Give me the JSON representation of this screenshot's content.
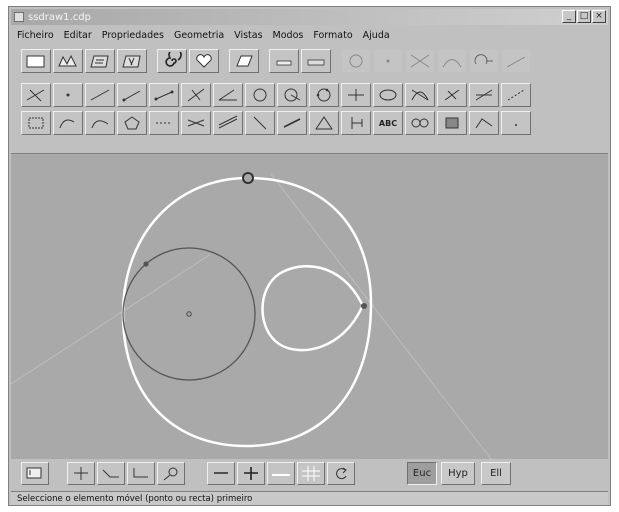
{
  "window": {
    "title": "ssdraw1.cdp"
  },
  "menu": [
    "Ficheiro",
    "Editar",
    "Propriedades",
    "Geometria",
    "Vistas",
    "Modos",
    "Formato",
    "Ajuda"
  ],
  "toolbar1": [
    "new-document-icon",
    "open-file-icon",
    "save-file-icon",
    "save-as-icon",
    "spiral-icon",
    "heart-icon",
    "print-icon",
    "eraser-icon",
    "rubber-icon",
    "circle-tool-icon",
    "dot-tool-icon",
    "tangent-lines-icon",
    "curve-tool-icon",
    "arc-tool-icon",
    "slant-line-icon"
  ],
  "toolbar2": [
    "point-icon",
    "midpoint-icon",
    "line-icon",
    "ray-icon",
    "segment-icon",
    "perpendicular-icon",
    "angle-icon",
    "circle-icon",
    "circle-radius-icon",
    "circle-3pt-icon",
    "intersection-icon",
    "ellipse-icon",
    "locus-icon",
    "reflect-icon",
    "rotate-icon",
    "translate-icon"
  ],
  "toolbar3": [
    "polygon-icon",
    "arc-icon",
    "arc3-icon",
    "pentagon-icon",
    "bisector-icon",
    "parallel-icon",
    "tangent-icon",
    "angle-bisector-icon",
    "vector-icon",
    "triangle-icon",
    "transform-icon",
    "text-icon",
    "link-icon",
    "fill-icon",
    "function-icon",
    "small-point-icon"
  ],
  "text_button_label": "ABC",
  "bottom_tools": [
    "cursor-select-icon",
    "move-icon",
    "stretch-icon",
    "scale-icon",
    "zoom-icon",
    "horizontal-rule-icon",
    "cross-icon",
    "ruler-icon",
    "grid-icon",
    "rotate-arrow-icon"
  ],
  "modes": [
    {
      "label": "Euc",
      "active": true
    },
    {
      "label": "Hyp",
      "active": false
    },
    {
      "label": "Ell",
      "active": false
    }
  ],
  "status": "Seleccione o elemento móvel (ponto ou recta) primeiro",
  "colors": {
    "window": "#c0c0c0",
    "canvas": "#a9a9a9",
    "curve": "#ffffff",
    "circle": "#555555"
  }
}
